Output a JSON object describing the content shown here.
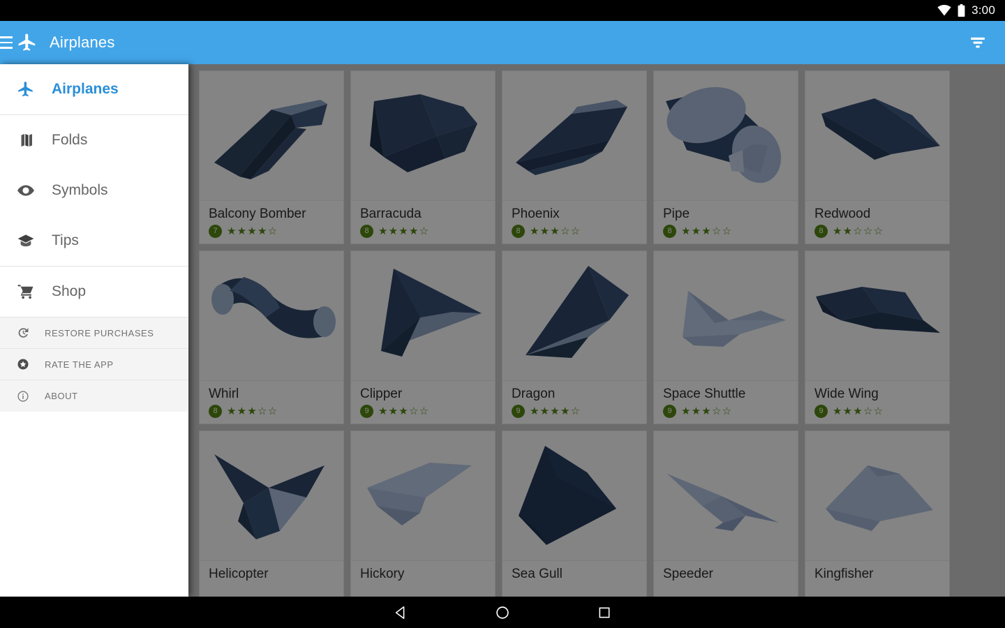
{
  "status_bar": {
    "time": "3:00",
    "icons": [
      "wifi-icon",
      "battery-icon"
    ]
  },
  "app_bar": {
    "title": "Airplanes",
    "menu_icon": "hamburger-icon",
    "brand_icon": "airplane-icon",
    "action_icon": "filter-icon",
    "background_color": "#42a5e8"
  },
  "drawer": {
    "primary_items": [
      {
        "label": "Airplanes",
        "icon": "airplane-icon",
        "active": true
      },
      {
        "label": "Folds",
        "icon": "map-icon",
        "active": false
      },
      {
        "label": "Symbols",
        "icon": "eye-icon",
        "active": false
      },
      {
        "label": "Tips",
        "icon": "graduation-cap-icon",
        "active": false
      }
    ],
    "shop_item": {
      "label": "Shop",
      "icon": "shopping-cart-icon"
    },
    "secondary_items": [
      {
        "label": "RESTORE PURCHASES",
        "icon": "history-icon"
      },
      {
        "label": "RATE THE APP",
        "icon": "star-circle-icon"
      },
      {
        "label": "ABOUT",
        "icon": "info-icon"
      }
    ],
    "active_color": "#2a8fd8"
  },
  "grid": {
    "rating_color": "#4f7a14",
    "cards": [
      {
        "title": "Balcony Bomber",
        "badge": "7",
        "stars": "★★★★☆",
        "rating": 4,
        "shape": "dart"
      },
      {
        "title": "Barracuda",
        "badge": "8",
        "stars": "★★★★☆",
        "rating": 4,
        "shape": "barracuda"
      },
      {
        "title": "Phoenix",
        "badge": "8",
        "stars": "★★★☆☆",
        "rating": 3,
        "shape": "phoenix"
      },
      {
        "title": "Pipe",
        "badge": "8",
        "stars": "★★★☆☆",
        "rating": 3,
        "shape": "pipe"
      },
      {
        "title": "Redwood",
        "badge": "8",
        "stars": "★★☆☆☆",
        "rating": 2,
        "shape": "redwood"
      },
      {
        "title": "Whirl",
        "badge": "8",
        "stars": "★★★☆☆",
        "rating": 3,
        "shape": "whirl"
      },
      {
        "title": "Clipper",
        "badge": "9",
        "stars": "★★★☆☆",
        "rating": 3,
        "shape": "clipper"
      },
      {
        "title": "Dragon",
        "badge": "9",
        "stars": "★★★★☆",
        "rating": 4,
        "shape": "dragon"
      },
      {
        "title": "Space Shuttle",
        "badge": "9",
        "stars": "★★★☆☆",
        "rating": 3,
        "shape": "shuttle"
      },
      {
        "title": "Wide Wing",
        "badge": "9",
        "stars": "★★★☆☆",
        "rating": 3,
        "shape": "widewing"
      },
      {
        "title": "Helicopter",
        "badge": "",
        "stars": "",
        "rating": 0,
        "shape": "helicopter"
      },
      {
        "title": "Hickory",
        "badge": "",
        "stars": "",
        "rating": 0,
        "shape": "hickory"
      },
      {
        "title": "Sea Gull",
        "badge": "",
        "stars": "",
        "rating": 0,
        "shape": "seagull"
      },
      {
        "title": "Speeder",
        "badge": "",
        "stars": "",
        "rating": 0,
        "shape": "speeder"
      },
      {
        "title": "Kingfisher",
        "badge": "",
        "stars": "",
        "rating": 0,
        "shape": "kingfisher"
      }
    ]
  },
  "system_nav": {
    "back_icon": "back-triangle-icon",
    "home_icon": "home-circle-icon",
    "recents_icon": "recents-square-icon"
  }
}
